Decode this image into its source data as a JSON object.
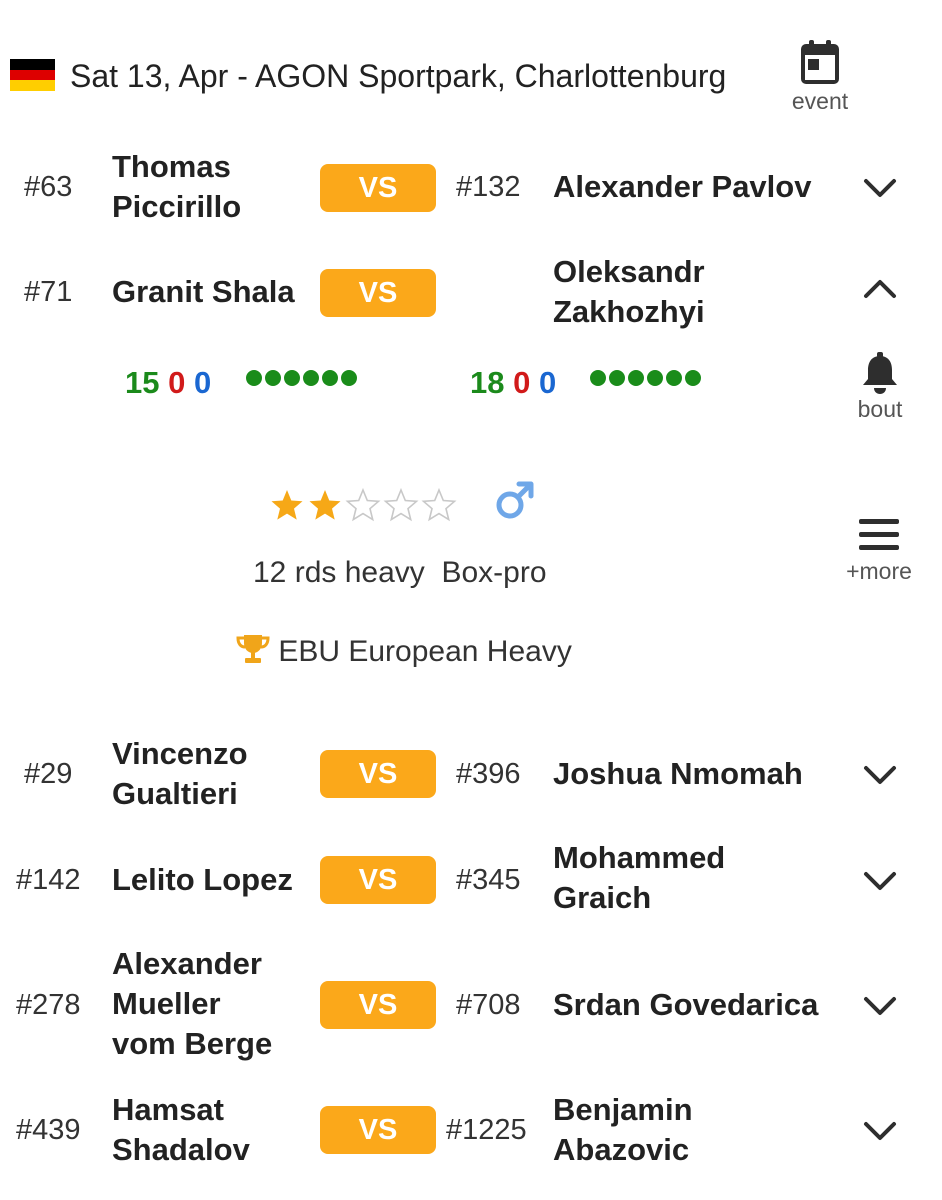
{
  "event": {
    "flag": "germany-flag",
    "title": "Sat 13, Apr  -  AGON Sportpark, Charlottenburg",
    "button_label": "event",
    "button_icon": "calendar-icon"
  },
  "colors": {
    "vs_button": "#fba81a",
    "win": "#1b8a1b",
    "loss": "#d11a1a",
    "draw": "#1a67d1",
    "star": "#f6a817",
    "male": "#6fa7e8"
  },
  "bouts": [
    {
      "rank_a": "#63",
      "name_a": [
        "Thomas",
        "Piccirillo"
      ],
      "vs": "VS",
      "rank_b": "#132",
      "name_b": [
        "Alexander Pavlov"
      ],
      "expanded": false
    },
    {
      "rank_a": "#71",
      "name_a": [
        "Granit Shala"
      ],
      "vs": "VS",
      "rank_b": "",
      "name_b": [
        "Oleksandr",
        "Zakhozhyi"
      ],
      "expanded": true
    },
    {
      "rank_a": "#29",
      "name_a": [
        "Vincenzo",
        "Gualtieri"
      ],
      "vs": "VS",
      "rank_b": "#396",
      "name_b": [
        "Joshua Nmomah"
      ],
      "expanded": false
    },
    {
      "rank_a": "#142",
      "name_a": [
        "Lelito Lopez"
      ],
      "vs": "VS",
      "rank_b": "#345",
      "name_b": [
        "Mohammed",
        "Graich"
      ],
      "expanded": false
    },
    {
      "rank_a": "#278",
      "name_a": [
        "Alexander",
        "Mueller",
        "vom Berge"
      ],
      "vs": "VS",
      "rank_b": "#708",
      "name_b": [
        "Srdan Govedarica"
      ],
      "expanded": false
    },
    {
      "rank_a": "#439",
      "name_a": [
        "Hamsat",
        "Shadalov"
      ],
      "vs": "VS",
      "rank_b": "#1225",
      "name_b": [
        "Benjamin",
        "Abazovic"
      ],
      "expanded": false
    }
  ],
  "details": {
    "record_a": {
      "w": "15",
      "l": "0",
      "d": "0",
      "last_results": 6
    },
    "record_b": {
      "w": "18",
      "l": "0",
      "d": "0",
      "last_results": 6
    },
    "rating_stars": 2,
    "rating_max": 5,
    "gender_icon": "male-icon",
    "rounds_weight": "12 rds heavy",
    "sport": "Box-pro",
    "title_icon": "trophy-icon",
    "title_belt": "EBU European Heavy",
    "bout_button_label": "bout",
    "bout_button_icon": "bell-icon",
    "more_button_label": "+more",
    "more_button_icon": "menu-icon"
  }
}
